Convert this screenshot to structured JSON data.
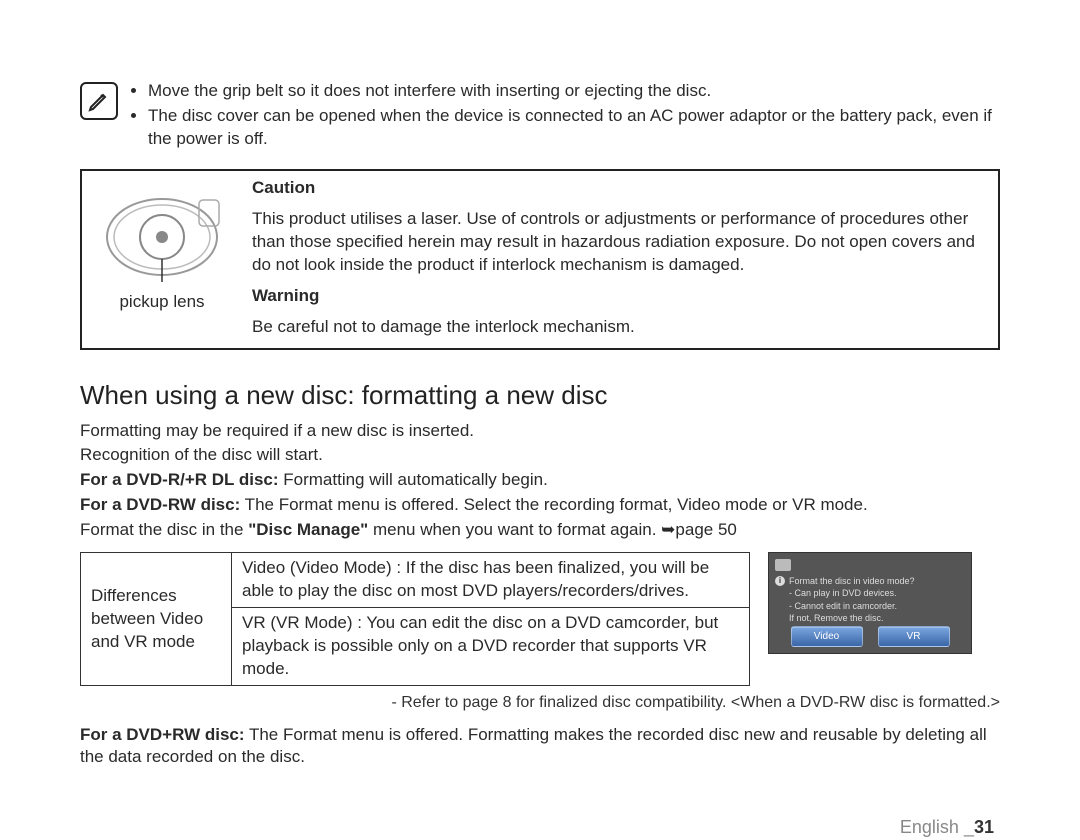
{
  "notes": {
    "items": [
      "Move the grip belt so it does not interfere with inserting or ejecting the disc.",
      "The disc cover can be opened when the device is connected to an AC power adaptor or the battery pack, even if the power is off."
    ]
  },
  "cautionBox": {
    "illustration_caption": "pickup lens",
    "caution_heading": "Caution",
    "caution_text": "This product utilises a laser. Use of controls or adjustments or performance of procedures other than those specified herein may result in hazardous radiation exposure. Do not open covers and do not look inside the product if interlock mechanism is damaged.",
    "warning_heading": "Warning",
    "warning_text": "Be careful not to damage the interlock mechanism."
  },
  "section": {
    "title": "When using a new disc: formatting a new disc",
    "p1": "Formatting may be required if a new disc is inserted.",
    "p2": "Recognition of the disc will start.",
    "p3_bold": "For a DVD-R/+R DL disc:",
    "p3_rest": " Formatting will automatically begin.",
    "p4_bold": "For a DVD-RW disc:",
    "p4_rest": " The Format menu is offered. Select the recording format, Video mode or VR mode.",
    "p5_pre": "Format the disc in the ",
    "p5_bold": "\"Disc Manage\"",
    "p5_post": " menu when you want to format again. ➥page 50"
  },
  "diffTable": {
    "rowHeader": "Differences between Video and VR mode",
    "videoCell": "Video (Video Mode) : If the disc has been finalized, you will be able to play the disc on most DVD players/recorders/drives.",
    "vrCell": "VR (VR Mode) : You can edit the disc on a DVD camcorder, but playback is possible only on a DVD recorder that supports VR mode."
  },
  "dialog": {
    "line1": "Format the disc in video mode?",
    "line2": "- Can play in DVD devices.",
    "line3": "- Cannot edit in camcorder.",
    "line4": "If not, Remove the disc.",
    "btn_video": "Video",
    "btn_vr": "VR"
  },
  "referLine": "- Refer to page 8 for finalized disc compatibility.   <When a DVD-RW disc is formatted.>",
  "p6_bold": "For a DVD+RW disc:",
  "p6_rest": " The Format menu is offered. Formatting makes the recorded disc new and reusable by deleting all the data recorded on the disc.",
  "footer": {
    "lang": "English _",
    "page": "31"
  }
}
